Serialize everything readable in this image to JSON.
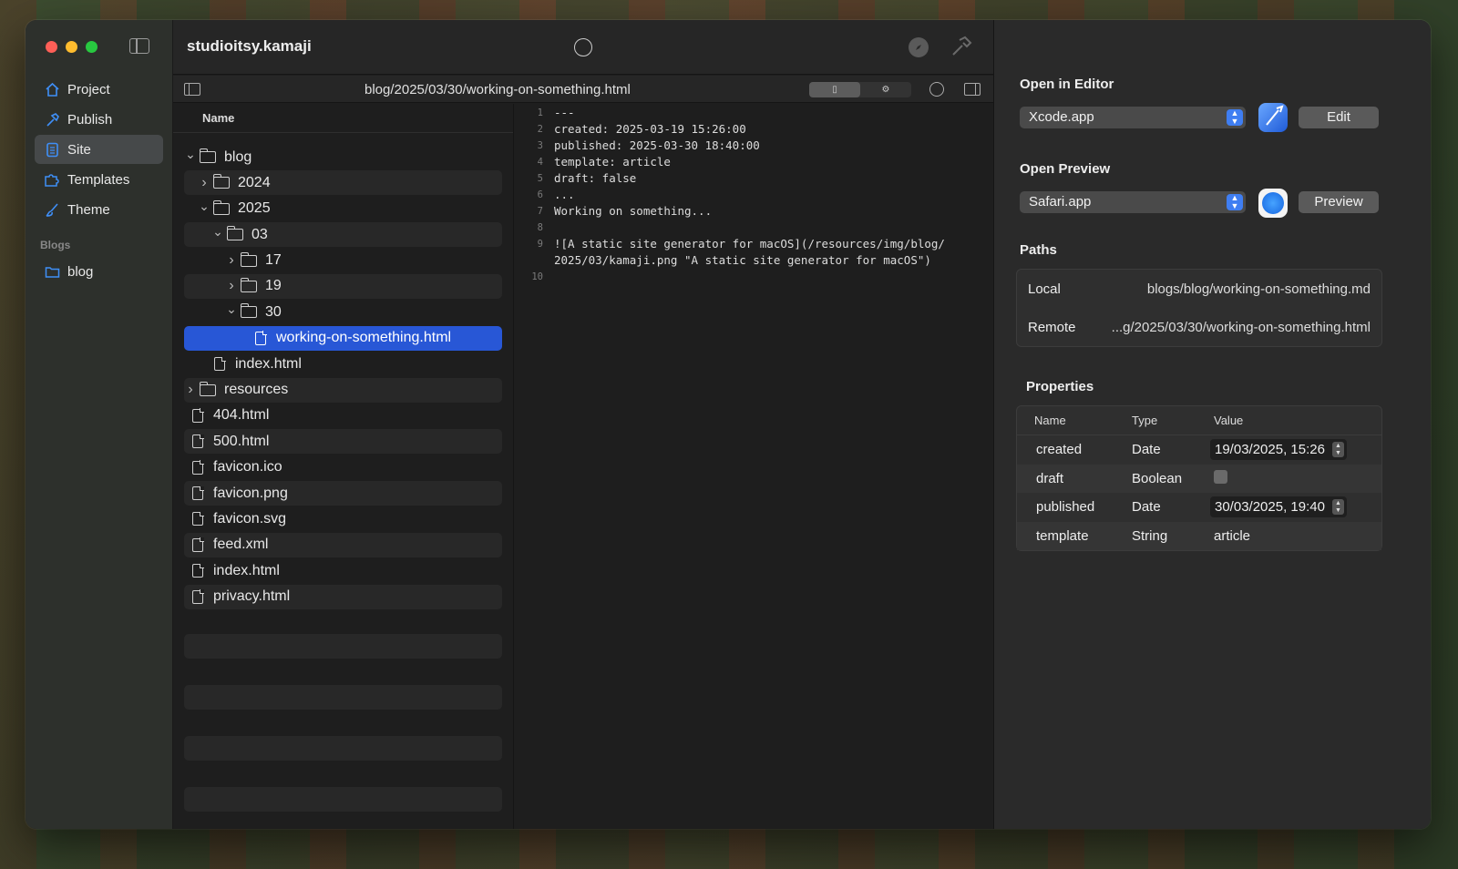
{
  "app": {
    "title": "studioitsy.kamaji",
    "path": "blog/2025/03/30/working-on-something.html"
  },
  "sidebar": {
    "items": [
      {
        "label": "Project",
        "icon": "house-icon"
      },
      {
        "label": "Publish",
        "icon": "hammer-icon"
      },
      {
        "label": "Site",
        "icon": "document-icon",
        "active": true
      },
      {
        "label": "Templates",
        "icon": "puzzle-icon"
      },
      {
        "label": "Theme",
        "icon": "brush-icon"
      }
    ],
    "blogs_title": "Blogs",
    "blogs": [
      {
        "label": "blog",
        "icon": "folder-icon"
      }
    ]
  },
  "tree": {
    "header": "Name",
    "rows": [
      {
        "label": "blog",
        "kind": "folder",
        "depth": 0,
        "chevron": "down"
      },
      {
        "label": "2024",
        "kind": "folder",
        "depth": 1,
        "chevron": "right"
      },
      {
        "label": "2025",
        "kind": "folder",
        "depth": 1,
        "chevron": "down"
      },
      {
        "label": "03",
        "kind": "folder",
        "depth": 2,
        "chevron": "down"
      },
      {
        "label": "17",
        "kind": "folder",
        "depth": 3,
        "chevron": "right"
      },
      {
        "label": "19",
        "kind": "folder",
        "depth": 3,
        "chevron": "right"
      },
      {
        "label": "30",
        "kind": "folder",
        "depth": 3,
        "chevron": "down"
      },
      {
        "label": "working-on-something.html",
        "kind": "file",
        "depth": 4,
        "selected": true
      },
      {
        "label": "index.html",
        "kind": "file",
        "depth": 1
      },
      {
        "label": "resources",
        "kind": "folder",
        "depth": 0,
        "chevron": "right"
      },
      {
        "label": "404.html",
        "kind": "file",
        "depth": 0
      },
      {
        "label": "500.html",
        "kind": "file",
        "depth": 0
      },
      {
        "label": "favicon.ico",
        "kind": "file",
        "depth": 0
      },
      {
        "label": "favicon.png",
        "kind": "file",
        "depth": 0
      },
      {
        "label": "favicon.svg",
        "kind": "file",
        "depth": 0
      },
      {
        "label": "feed.xml",
        "kind": "file",
        "depth": 0
      },
      {
        "label": "index.html",
        "kind": "file",
        "depth": 0
      },
      {
        "label": "privacy.html",
        "kind": "file",
        "depth": 0
      }
    ]
  },
  "editor": {
    "lines": [
      {
        "n": "1",
        "text": "---"
      },
      {
        "n": "2",
        "text": "created: 2025-03-19 15:26:00"
      },
      {
        "n": "3",
        "text": "published: 2025-03-30 18:40:00"
      },
      {
        "n": "4",
        "text": "template: article"
      },
      {
        "n": "5",
        "text": "draft: false"
      },
      {
        "n": "6",
        "text": "..."
      },
      {
        "n": "7",
        "text": "Working on something..."
      },
      {
        "n": "8",
        "text": ""
      },
      {
        "n": "9",
        "text": "![A static site generator for macOS](/resources/img/blog/"
      },
      {
        "n": "",
        "text": "2025/03/kamaji.png \"A static site generator for macOS\")"
      },
      {
        "n": "10",
        "text": ""
      }
    ]
  },
  "inspector": {
    "open_editor": {
      "title": "Open in Editor",
      "app": "Xcode.app",
      "button": "Edit"
    },
    "open_preview": {
      "title": "Open Preview",
      "app": "Safari.app",
      "button": "Preview"
    },
    "paths": {
      "title": "Paths",
      "local_label": "Local",
      "local_value": "blogs/blog/working-on-something.md",
      "remote_label": "Remote",
      "remote_value": "...g/2025/03/30/working-on-something.html"
    },
    "properties": {
      "title": "Properties",
      "col_name": "Name",
      "col_type": "Type",
      "col_value": "Value",
      "rows": [
        {
          "name": "created",
          "type": "Date",
          "value": "19/03/2025, 15:26",
          "kind": "date"
        },
        {
          "name": "draft",
          "type": "Boolean",
          "value": "",
          "kind": "bool"
        },
        {
          "name": "published",
          "type": "Date",
          "value": "30/03/2025, 19:40",
          "kind": "date"
        },
        {
          "name": "template",
          "type": "String",
          "value": "article",
          "kind": "text"
        }
      ]
    }
  },
  "colors": {
    "accent": "#2857d6",
    "sidebar_icon": "#3f8ff7"
  }
}
